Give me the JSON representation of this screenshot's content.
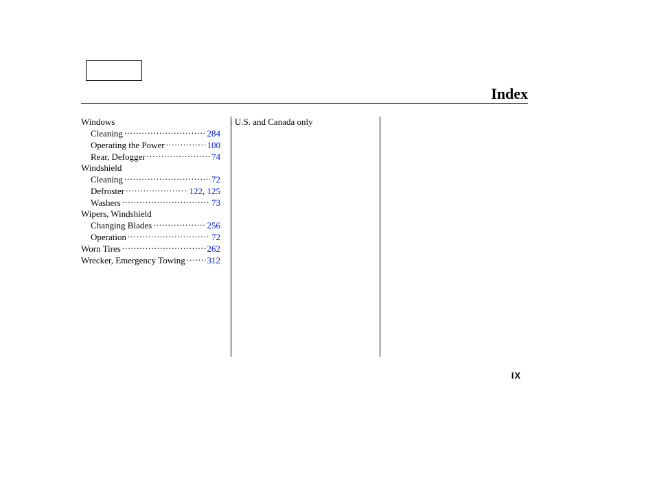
{
  "header": {
    "title": "Index"
  },
  "note_col2": ": U.S. and Canada only",
  "page_number": "IX",
  "index": [
    {
      "type": "heading",
      "label": "Windows"
    },
    {
      "type": "sub",
      "label": "Cleaning",
      "pages": [
        "284"
      ]
    },
    {
      "type": "sub",
      "label": "Operating the Power",
      "pages": [
        "100"
      ]
    },
    {
      "type": "sub",
      "label": "Rear, Defogger",
      "pages": [
        "74"
      ]
    },
    {
      "type": "heading",
      "label": "Windshield"
    },
    {
      "type": "sub",
      "label": "Cleaning",
      "pages": [
        "72"
      ]
    },
    {
      "type": "sub",
      "label": "Defroster",
      "pages": [
        "122",
        "125"
      ]
    },
    {
      "type": "sub",
      "label": "Washers",
      "pages": [
        "73"
      ]
    },
    {
      "type": "heading",
      "label": "Wipers, Windshield"
    },
    {
      "type": "sub",
      "label": "Changing Blades",
      "pages": [
        "256"
      ]
    },
    {
      "type": "sub",
      "label": "Operation",
      "pages": [
        "72"
      ]
    },
    {
      "type": "entry",
      "label": "Worn Tires",
      "pages": [
        "262"
      ]
    },
    {
      "type": "entry",
      "label": "Wrecker, Emergency Towing",
      "pages": [
        "312"
      ]
    }
  ]
}
